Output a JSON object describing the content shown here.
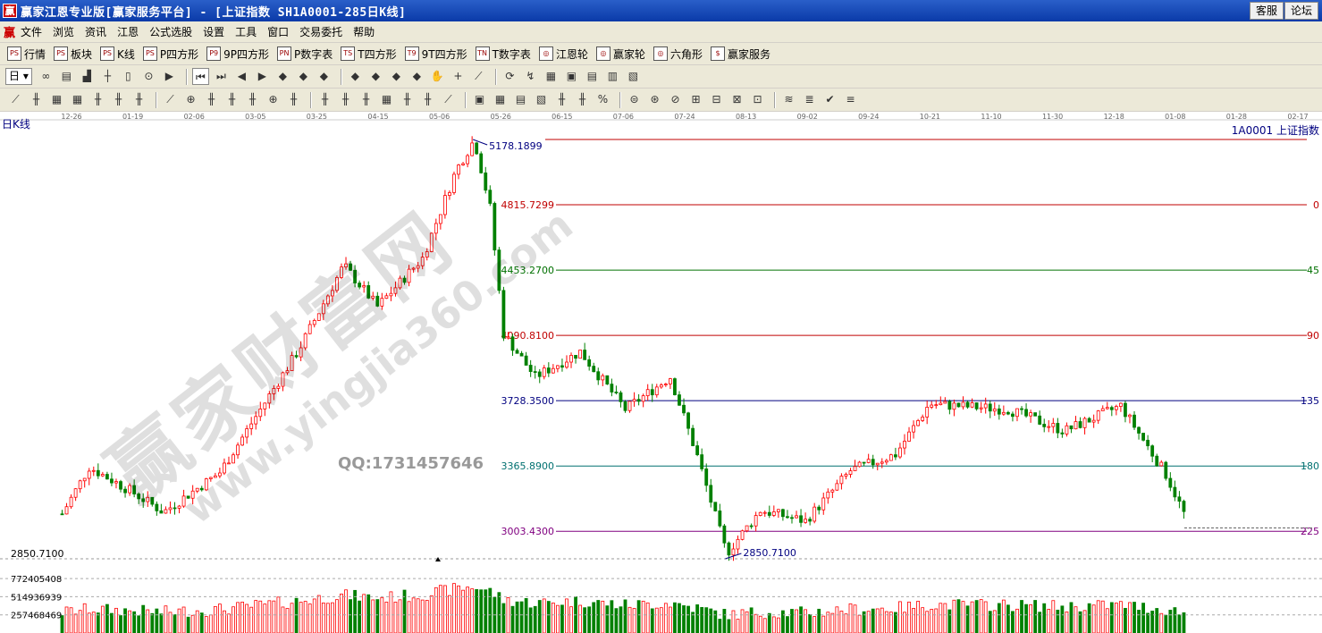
{
  "window": {
    "title": "赢家江恩专业版[赢家服务平台] - [上证指数   SH1A0001-285日K线]",
    "app_icon": "赢",
    "buttons": [
      "客服",
      "论坛"
    ]
  },
  "menu": {
    "logo": "赢",
    "items": [
      "文件",
      "浏览",
      "资讯",
      "江恩",
      "公式选股",
      "设置",
      "工具",
      "窗口",
      "交易委托",
      "帮助"
    ]
  },
  "toolbar1": {
    "items": [
      {
        "icon": "PS",
        "label": "行情"
      },
      {
        "icon": "PS",
        "label": "板块"
      },
      {
        "icon": "PS",
        "label": "K线"
      },
      {
        "icon": "PS",
        "label": "P四方形"
      },
      {
        "icon": "P9",
        "label": "9P四方形"
      },
      {
        "icon": "PN",
        "label": "P数字表"
      },
      {
        "icon": "TS",
        "label": "T四方形"
      },
      {
        "icon": "T9",
        "label": "9T四方形"
      },
      {
        "icon": "TN",
        "label": "T数字表"
      },
      {
        "icon": "◎",
        "label": "江恩轮"
      },
      {
        "icon": "◎",
        "label": "赢家轮"
      },
      {
        "icon": "◎",
        "label": "六角形"
      },
      {
        "icon": "$",
        "label": "赢家服务"
      }
    ]
  },
  "toolbar2": {
    "period": "日",
    "icons": [
      "∞",
      "▤",
      "▟",
      "┼",
      "▯",
      "⊙",
      "▶",
      "⏮",
      "⏭",
      "◀",
      "▶",
      "◆",
      "◆",
      "◆",
      "◆",
      "◆",
      "◆",
      "◆",
      "✋",
      "+",
      "⟋",
      "⟳",
      "↯",
      "▦",
      "▣",
      "▤",
      "▥",
      "▧"
    ],
    "active_index": 7
  },
  "toolbar3": {
    "icons": [
      "⟋",
      "╫",
      "▦",
      "▦",
      "╫",
      "╫",
      "╫",
      "⟋",
      "⊕",
      "╫",
      "╫",
      "╫",
      "⊕",
      "╫",
      "╫",
      "╫",
      "╫",
      "▦",
      "╫",
      "╫",
      "⟋",
      "▣",
      "▦",
      "▤",
      "▧",
      "╫",
      "╫",
      "%",
      "⊜",
      "⊛",
      "⊘",
      "⊞",
      "⊟",
      "⊠",
      "⊡",
      "≋",
      "≣",
      "✔",
      "≡"
    ]
  },
  "chart": {
    "panel_label": "日K线",
    "security_code": "1A0001",
    "security_name": "上证指数",
    "date_labels": [
      "12-26",
      "01-19",
      "02-06",
      "03-05",
      "03-25",
      "04-15",
      "05-06",
      "05-26",
      "06-15",
      "07-06",
      "07-24",
      "08-13",
      "09-02",
      "09-24",
      "10-21",
      "11-10",
      "11-30",
      "12-18",
      "01-08",
      "01-28",
      "02-17"
    ],
    "high_label": "5178.1899",
    "low_label": "2850.7100",
    "left_axis_low": "2850.7100",
    "gann_levels": [
      {
        "price": "4815.7299",
        "angle": "0",
        "color": "#c00000"
      },
      {
        "price": "4453.2700",
        "angle": "45",
        "color": "#007000"
      },
      {
        "price": "4090.8100",
        "angle": "90",
        "color": "#c00000"
      },
      {
        "price": "3728.3500",
        "angle": "135",
        "color": "#000080"
      },
      {
        "price": "3365.8900",
        "angle": "180",
        "color": "#007070"
      },
      {
        "price": "3003.4300",
        "angle": "225",
        "color": "#800080"
      }
    ],
    "volume_labels": [
      "772405408",
      "514936939",
      "257468469"
    ],
    "up_color": "#ff0000",
    "down_color": "#008000"
  },
  "watermark": {
    "cn": "赢家财富网",
    "url": "www.yingjia360.com",
    "qq": "QQ:1731457646"
  }
}
